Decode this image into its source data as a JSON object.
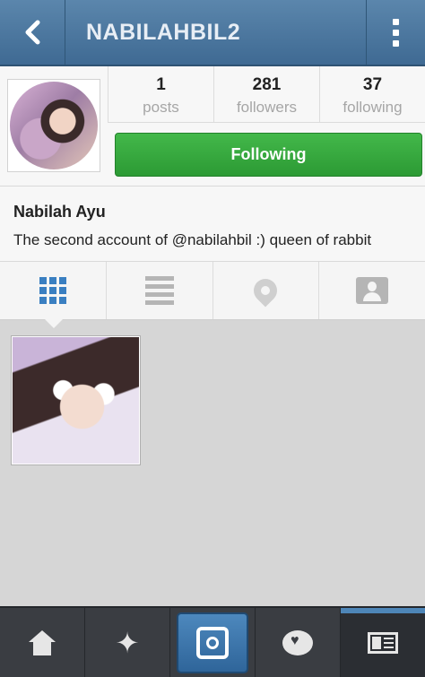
{
  "header": {
    "title": "NABILAHBIL2",
    "back_icon": "chevron-left-icon",
    "menu_icon": "overflow-menu-icon"
  },
  "profile": {
    "stats": [
      {
        "value": "1",
        "label": "posts"
      },
      {
        "value": "281",
        "label": "followers"
      },
      {
        "value": "37",
        "label": "following"
      }
    ],
    "follow_button": "Following",
    "name": "Nabilah Ayu",
    "bio": "The second account of @nabilahbil :) queen of rabbit"
  },
  "view_tabs": [
    {
      "icon": "grid-icon",
      "active": true
    },
    {
      "icon": "list-icon",
      "active": false
    },
    {
      "icon": "location-pin-icon",
      "active": false
    },
    {
      "icon": "tagged-person-icon",
      "active": false
    }
  ],
  "bottom_nav": [
    {
      "icon": "home-icon"
    },
    {
      "icon": "explore-star-icon"
    },
    {
      "icon": "camera-icon"
    },
    {
      "icon": "activity-bubble-icon"
    },
    {
      "icon": "profile-news-icon"
    }
  ],
  "colors": {
    "topbar": "#4a76a0",
    "follow_green": "#37a93f",
    "nav_dark": "#3a3d42",
    "accent_blue": "#3a7fc1"
  }
}
